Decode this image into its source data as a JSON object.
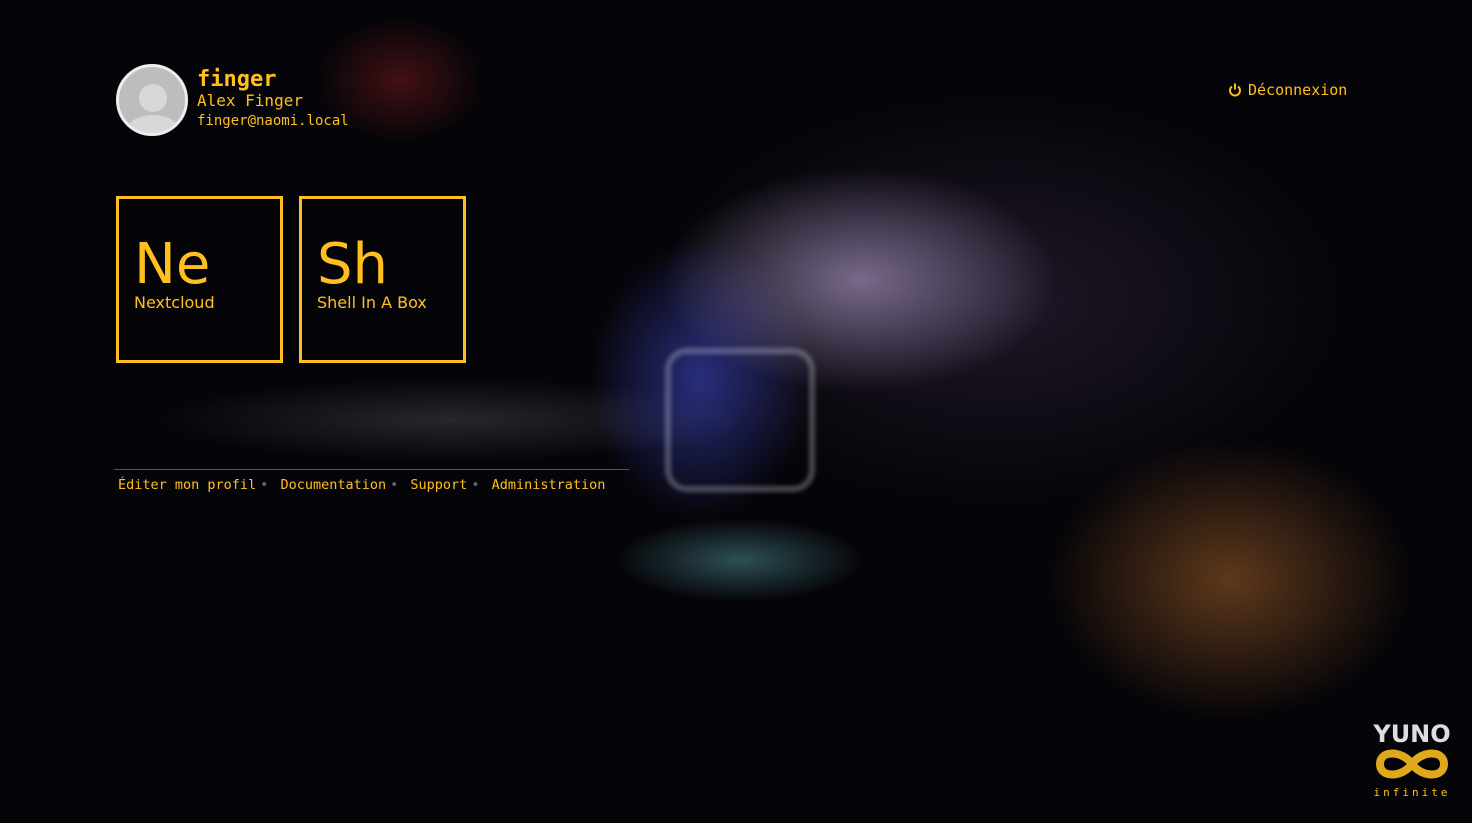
{
  "user": {
    "username": "finger",
    "fullname": "Alex Finger",
    "email": "finger@naomi.local"
  },
  "logout": {
    "label": "Déconnexion",
    "icon": "power-icon"
  },
  "apps": [
    {
      "abbr": "Ne",
      "name": "Nextcloud"
    },
    {
      "abbr": "Sh",
      "name": "Shell In A Box"
    }
  ],
  "footer": {
    "links": [
      "Éditer mon profil",
      "Documentation",
      "Support",
      "Administration"
    ],
    "separator": "•"
  },
  "logo": {
    "text": "YUNO",
    "subtitle": "infinite"
  },
  "colors": {
    "accent": "#ffc01f"
  }
}
